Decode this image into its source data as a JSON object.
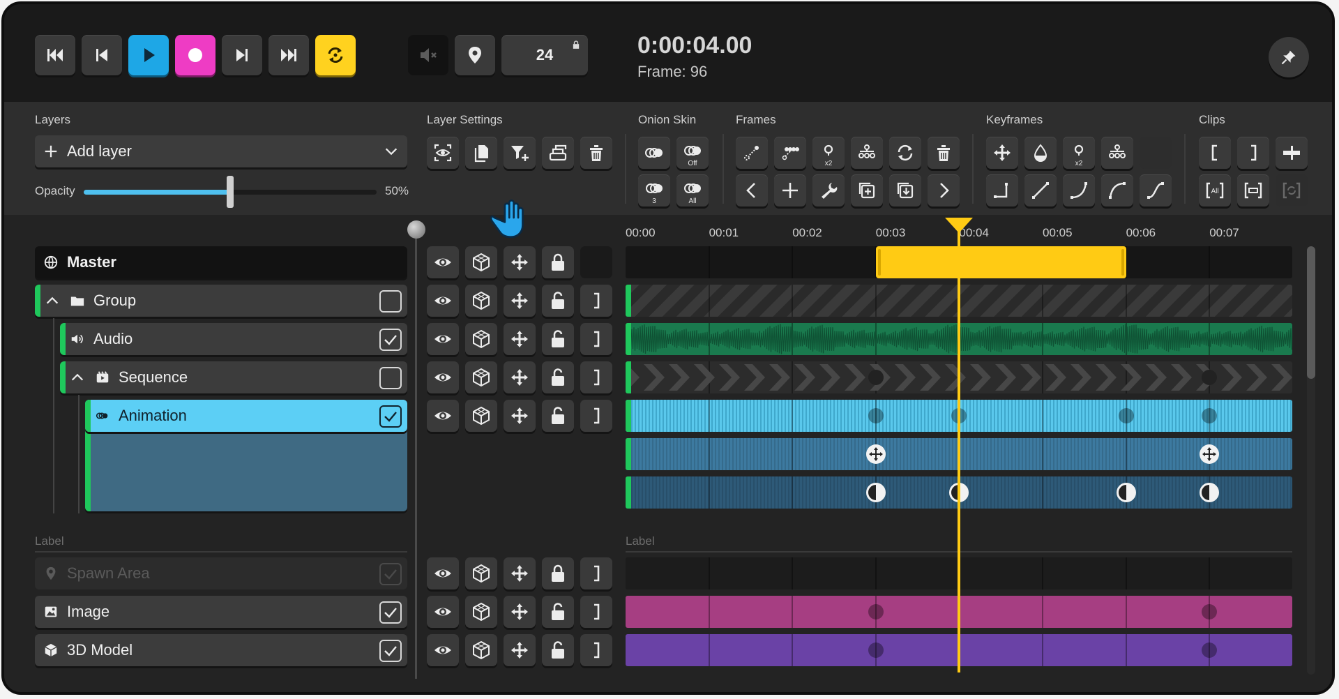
{
  "transport": {
    "fps": "24",
    "timecode": "0:00:04.00",
    "frame_label": "Frame: 96",
    "colors": {
      "play": "#1ea7e6",
      "record": "#ee3cc4",
      "loop": "#ffd21f"
    }
  },
  "tools": {
    "layers_label": "Layers",
    "add_layer_label": "Add layer",
    "opacity_label": "Opacity",
    "opacity_value": "50%",
    "opacity_fraction": 0.5,
    "layer_settings_label": "Layer Settings",
    "onion_skin_label": "Onion Skin",
    "onion_off": "Off",
    "onion_three": "3",
    "onion_all": "All",
    "frames_label": "Frames",
    "frames_x2": "x2",
    "keyframes_label": "Keyframes",
    "keyframes_x2": "x2",
    "clips_label": "Clips",
    "clip_all": "All"
  },
  "timeline": {
    "ticks": [
      "00:00",
      "00:01",
      "00:02",
      "00:03",
      "00:04",
      "00:05",
      "00:06",
      "00:07"
    ],
    "playhead_seconds": 4,
    "work_area_seconds": [
      3,
      6
    ],
    "label_left": "Label",
    "label_right": "Label"
  },
  "layers": {
    "master": "Master",
    "group": "Group",
    "audio": "Audio",
    "sequence": "Sequence",
    "animation": "Animation",
    "spawn_area": "Spawn Area",
    "image": "Image",
    "model3d": "3D Model"
  },
  "track_colors": {
    "work_area": "#ffcb14",
    "audio": "#1a7a4e",
    "animation": "#5ac8ec",
    "image": "#a63e82",
    "model3d": "#6a42a6"
  }
}
